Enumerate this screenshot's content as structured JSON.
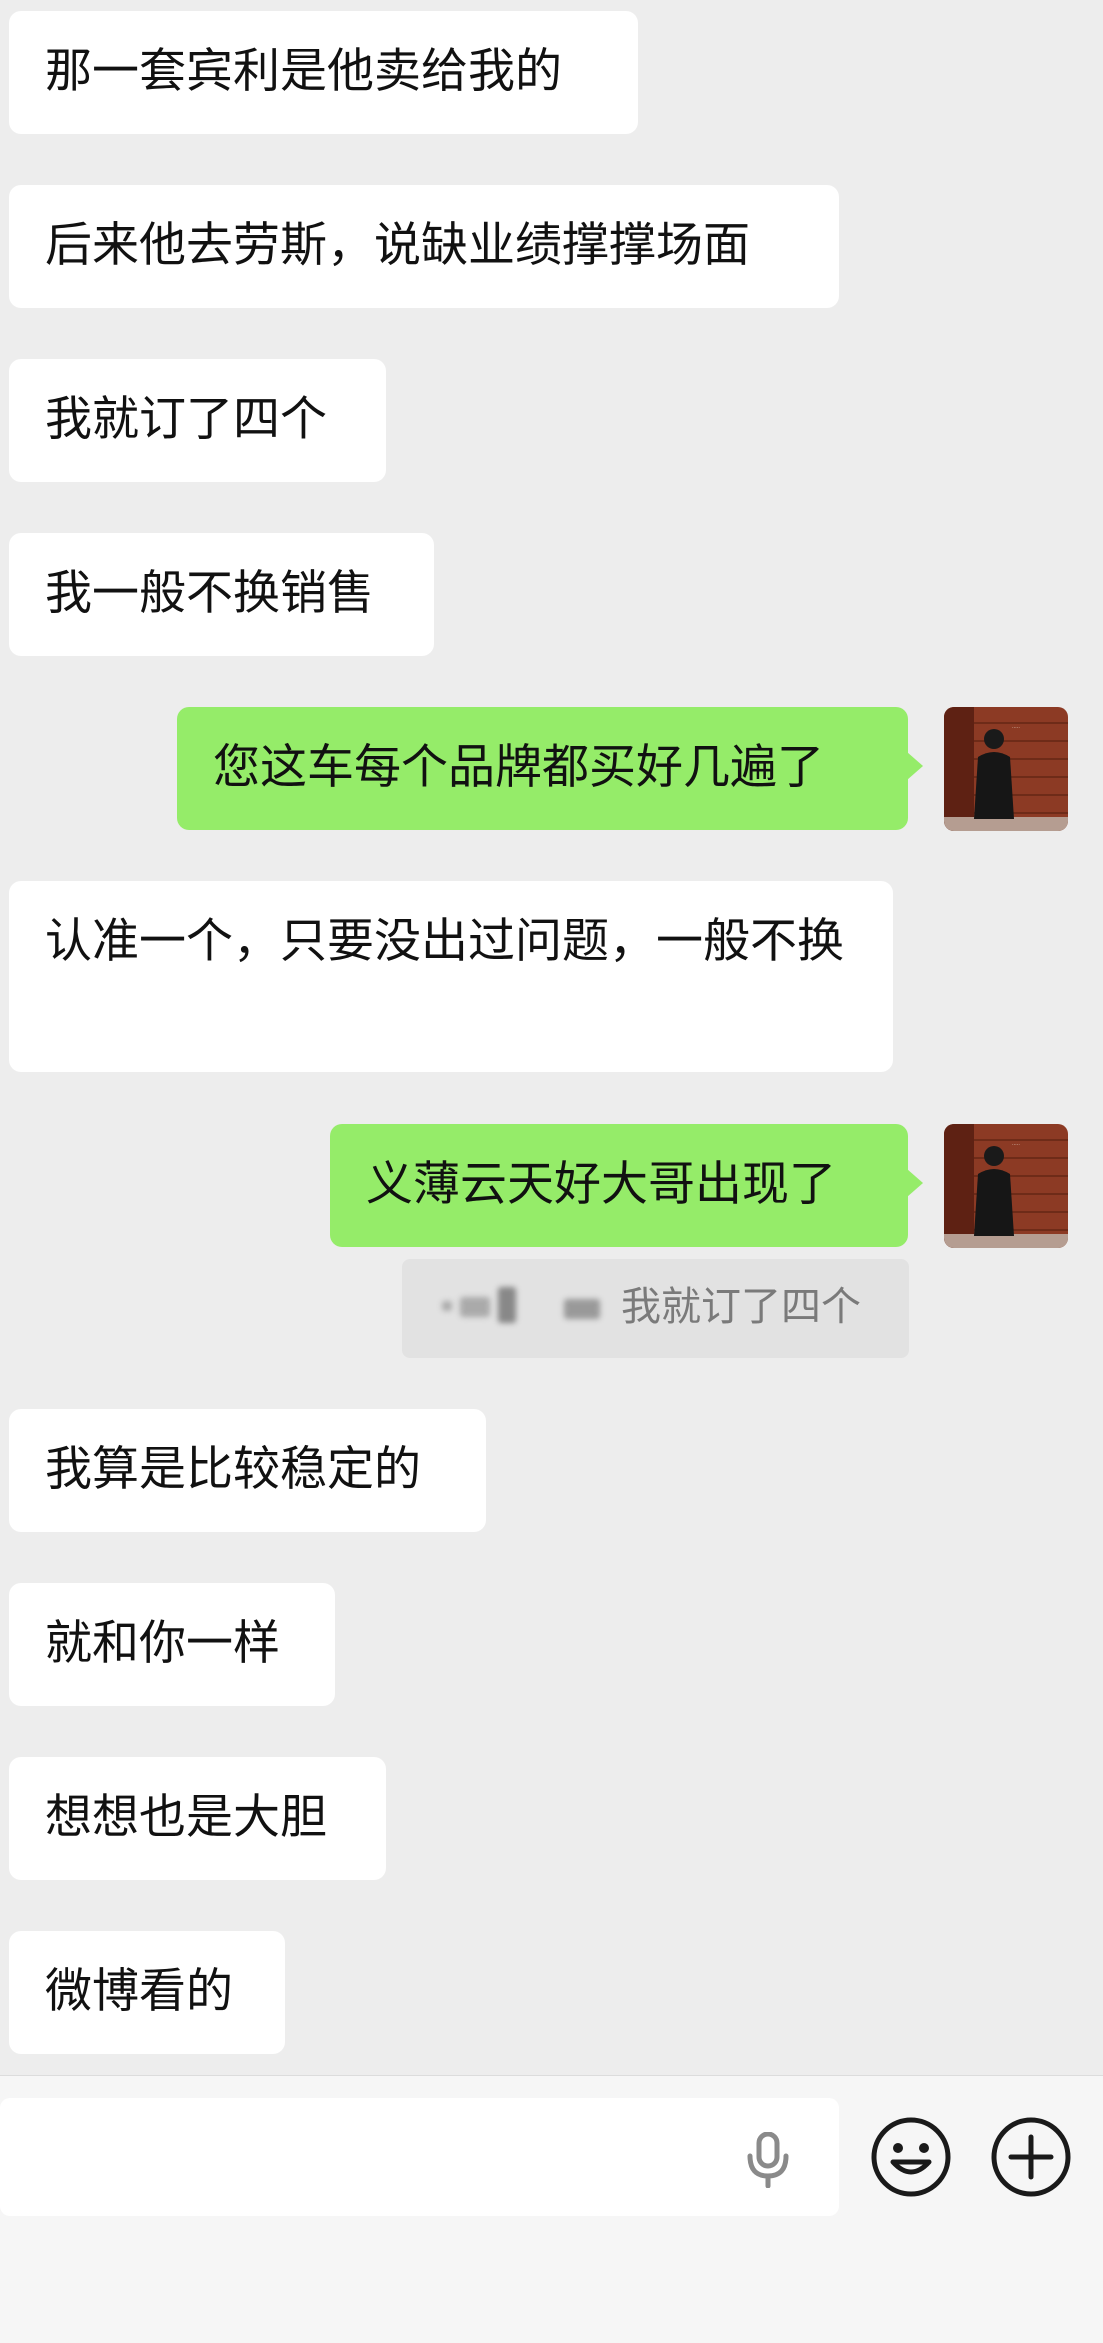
{
  "messages": [
    {
      "text": "那一套宾利是他卖给我的"
    },
    {
      "text": "后来他去劳斯，说缺业绩撑撑场面"
    },
    {
      "text": "我就订了四个"
    },
    {
      "text": "我一般不换销售"
    },
    {
      "text": "您这车每个品牌都买好几遍了"
    },
    {
      "text": "认准一个，只要没出过问题，一般不换"
    },
    {
      "text": "义薄云天好大哥出现了"
    },
    {
      "text": "我算是比较稳定的"
    },
    {
      "text": "就和你一样"
    },
    {
      "text": "想想也是大胆"
    },
    {
      "text": "微博看的"
    }
  ],
  "quote": {
    "text": "我就订了四个"
  },
  "input_bar": {
    "voice_icon": "microphone-icon",
    "emoji_icon": "smiley-emoji-icon",
    "more_icon": "plus-circle-icon"
  },
  "colors": {
    "background": "#ededed",
    "incoming_bubble": "#ffffff",
    "outgoing_bubble": "#95ec69",
    "quote_bubble": "#e2e2e2"
  }
}
